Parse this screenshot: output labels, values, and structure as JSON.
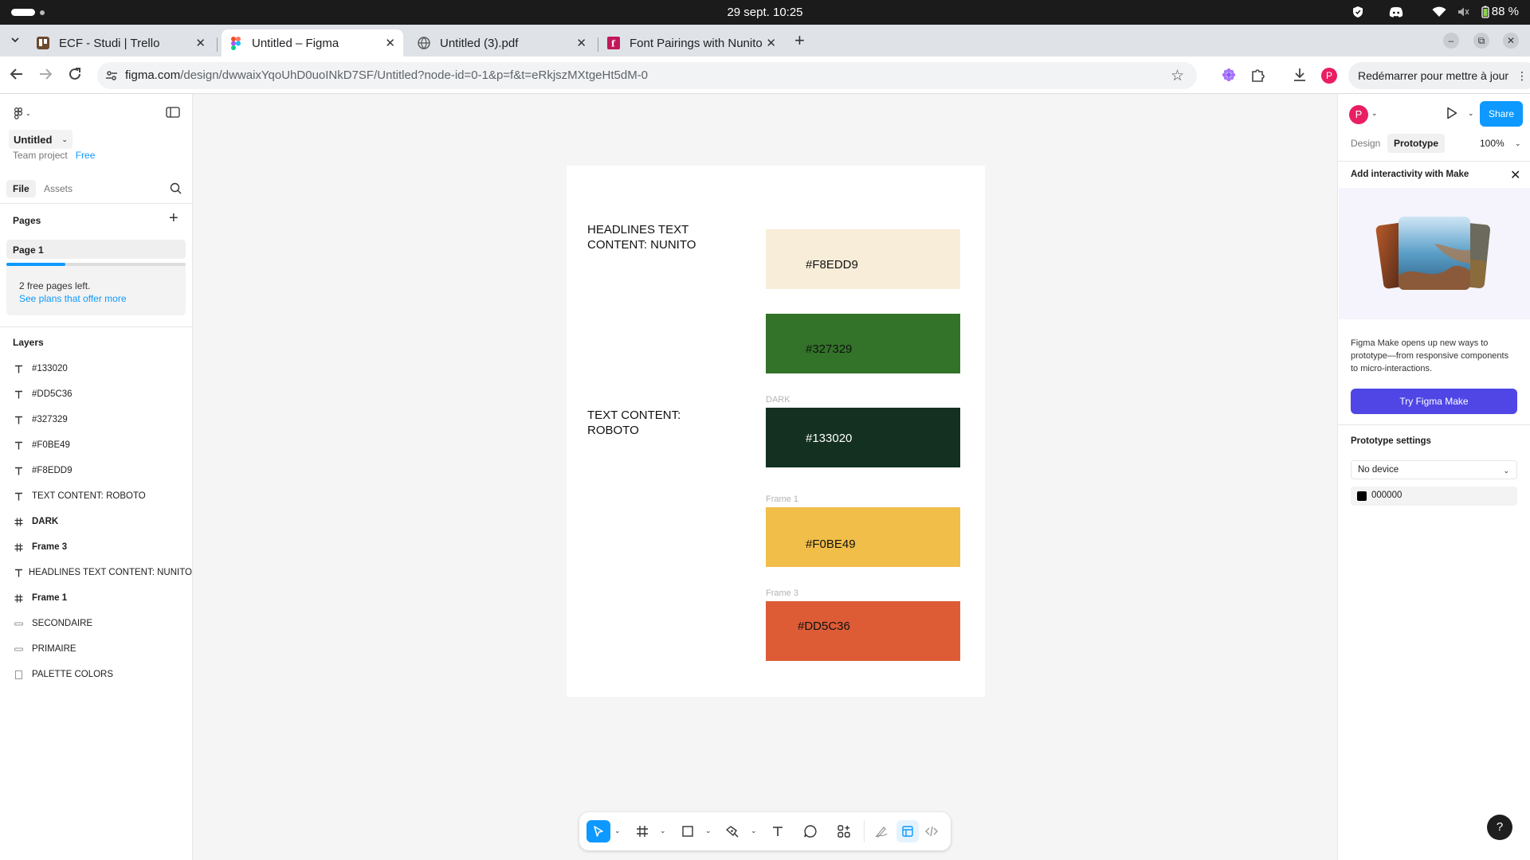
{
  "os": {
    "datetime": "29 sept.  10:25",
    "battery": "88 %"
  },
  "browser": {
    "tabs": [
      {
        "title": "ECF - Studi | Trello",
        "active": false
      },
      {
        "title": "Untitled – Figma",
        "active": true
      },
      {
        "title": "Untitled (3).pdf",
        "active": false
      },
      {
        "title": "Font Pairings with Nunito",
        "active": false
      }
    ],
    "url_host": "figma.com",
    "url_path": "/design/dwwaixYqoUhD0uoINkD7SF/Untitled?node-id=0-1&p=f&t=eRkjszMXtgeHt5dM-0",
    "profile_initial": "P",
    "restart_label": "Redémarrer pour mettre à jour"
  },
  "left": {
    "file_name": "Untitled",
    "team": "Team project",
    "plan": "Free",
    "tab_file": "File",
    "tab_assets": "Assets",
    "pages_heading": "Pages",
    "pages": [
      "Page 1"
    ],
    "free_pages_progress": 0.33,
    "notice_line1": "2 free pages left.",
    "notice_link": "See plans that offer more",
    "layers_heading": "Layers",
    "layers": [
      {
        "name": "#133020",
        "type": "text"
      },
      {
        "name": "#DD5C36",
        "type": "text"
      },
      {
        "name": "#327329",
        "type": "text"
      },
      {
        "name": "#F0BE49",
        "type": "text"
      },
      {
        "name": "#F8EDD9",
        "type": "text"
      },
      {
        "name": "TEXT CONTENT: ROBOTO",
        "type": "text"
      },
      {
        "name": "DARK",
        "type": "frame"
      },
      {
        "name": "Frame 3",
        "type": "frame"
      },
      {
        "name": "HEADLINES TEXT CONTENT: NUNITO",
        "type": "text"
      },
      {
        "name": "Frame 1",
        "type": "frame"
      },
      {
        "name": "SECONDAIRE",
        "type": "line"
      },
      {
        "name": "PRIMAIRE",
        "type": "line"
      },
      {
        "name": "PALETTE COLORS",
        "type": "rect"
      }
    ]
  },
  "canvas": {
    "headline_label": "HEADLINES TEXT CONTENT: NUNITO",
    "text_label": "TEXT CONTENT: ROBOTO",
    "frame_tags": {
      "dark": "DARK",
      "frame1": "Frame 1",
      "frame3": "Frame 3"
    },
    "swatches": [
      {
        "hex": "#F8EDD9",
        "color": "#F8EDD9",
        "text_color": "#111111"
      },
      {
        "hex": "#327329",
        "color": "#327329",
        "text_color": "#111111"
      },
      {
        "hex": "#133020",
        "color": "#133020",
        "text_color": "#FFFFFF"
      },
      {
        "hex": "#F0BE49",
        "color": "#F0BE49",
        "text_color": "#111111"
      },
      {
        "hex": "#DD5C36",
        "color": "#DD5C36",
        "text_color": "#111111"
      }
    ]
  },
  "right": {
    "avatar_initial": "P",
    "share_label": "Share",
    "tab_design": "Design",
    "tab_prototype": "Prototype",
    "zoom": "100%",
    "make_heading": "Add interactivity with Make",
    "make_text": "Figma Make opens up new ways to prototype—from responsive components to micro-interactions.",
    "make_button": "Try Figma Make",
    "settings_heading": "Prototype settings",
    "device": "No device",
    "bg_color": "000000",
    "help": "?"
  },
  "colors": {
    "accent": "#0D99FF",
    "make": "#4F46E5"
  }
}
